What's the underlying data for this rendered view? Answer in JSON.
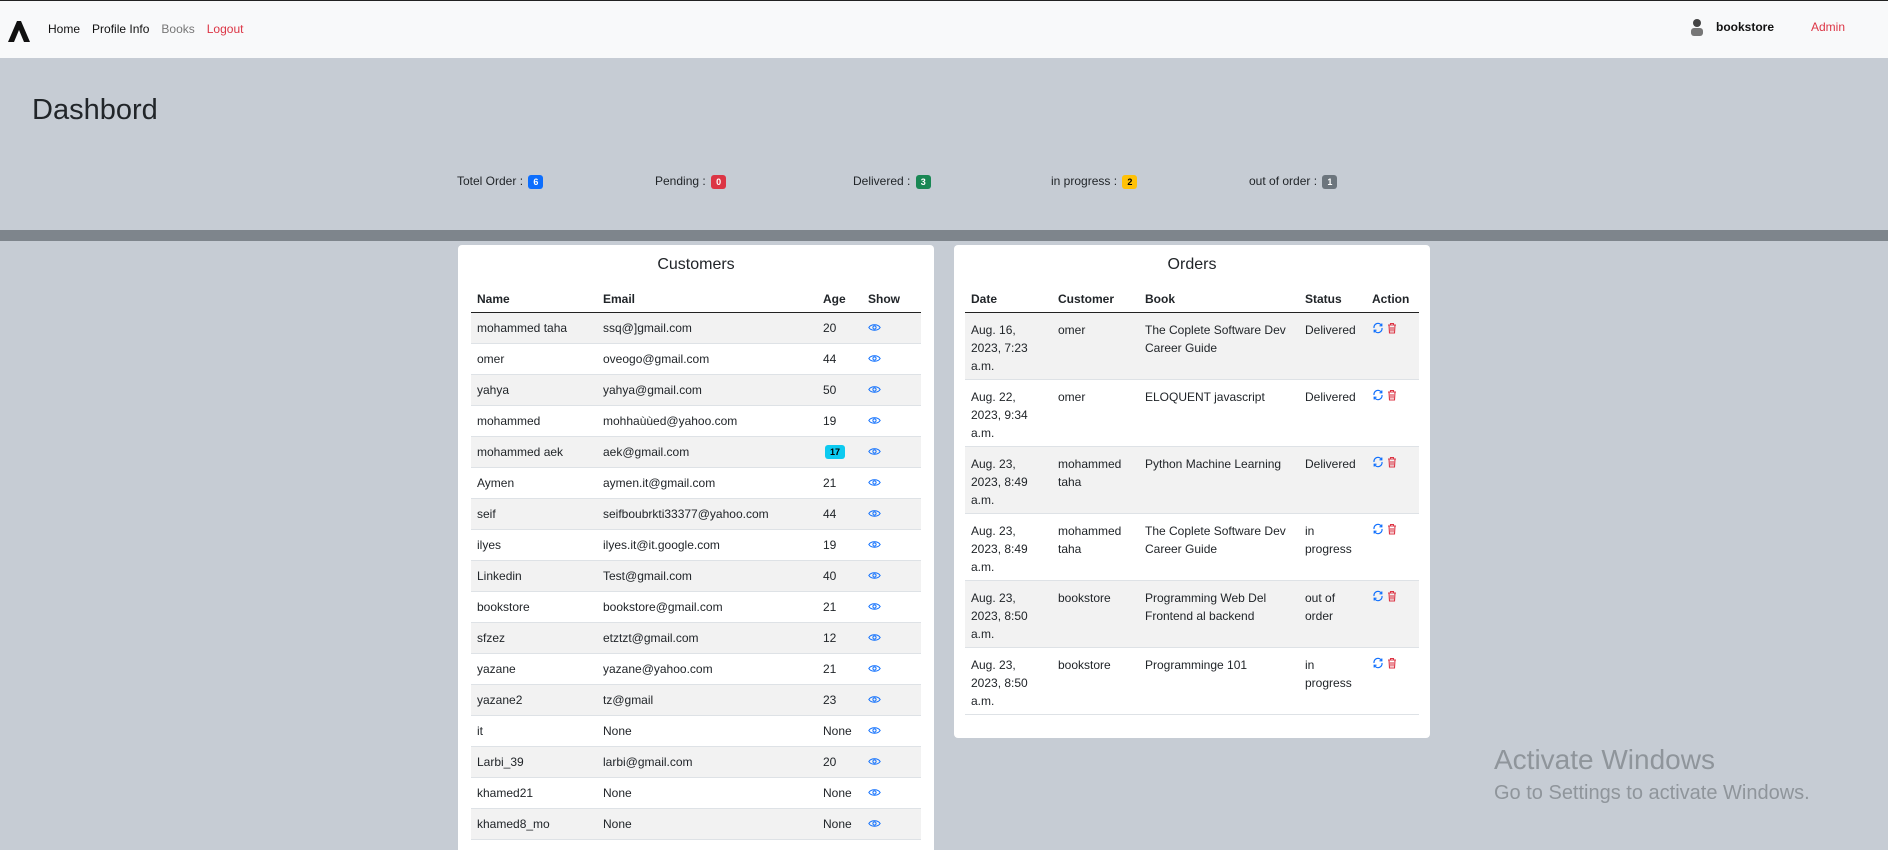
{
  "nav": {
    "links": [
      "Home",
      "Profile Info",
      "Books",
      "Logout"
    ],
    "user_name": "bookstore",
    "admin_label": "Admin"
  },
  "header": {
    "title": "Dashbord",
    "stats": [
      {
        "label": "Totel Order :",
        "value": "6",
        "color": "#0d6efd"
      },
      {
        "label": "Pending :",
        "value": "0",
        "color": "#dc3545"
      },
      {
        "label": "Delivered :",
        "value": "3",
        "color": "#198754"
      },
      {
        "label": "in progress :",
        "value": "2",
        "color": "#ffc107"
      },
      {
        "label": "out of order :",
        "value": "1",
        "color": "#6c757d"
      }
    ]
  },
  "customers": {
    "title": "Customers",
    "columns": [
      "Name",
      "Email",
      "Age",
      "Show"
    ],
    "rows": [
      {
        "name": "mohammed taha",
        "email": "ssq@]gmail.com",
        "age": "20"
      },
      {
        "name": "omer",
        "email": "oveogo@gmail.com",
        "age": "44"
      },
      {
        "name": "yahya",
        "email": "yahya@gmail.com",
        "age": "50"
      },
      {
        "name": "mohammed",
        "email": "mohhaùùed@yahoo.com",
        "age": "19"
      },
      {
        "name": "mohammed aek",
        "email": "aek@gmail.com",
        "age": "17",
        "age_badge": true
      },
      {
        "name": "Aymen",
        "email": "aymen.it@gmail.com",
        "age": "21"
      },
      {
        "name": "seif",
        "email": "seifboubrkti33377@yahoo.com",
        "age": "44"
      },
      {
        "name": "ilyes",
        "email": "ilyes.it@it.google.com",
        "age": "19"
      },
      {
        "name": "Linkedin",
        "email": "Test@gmail.com",
        "age": "40"
      },
      {
        "name": "bookstore",
        "email": "bookstore@gmail.com",
        "age": "21"
      },
      {
        "name": "sfzez",
        "email": "etztzt@gmail.com",
        "age": "12"
      },
      {
        "name": "yazane",
        "email": "yazane@yahoo.com",
        "age": "21"
      },
      {
        "name": "yazane2",
        "email": "tz@gmail",
        "age": "23"
      },
      {
        "name": "it",
        "email": "None",
        "age": "None"
      },
      {
        "name": "Larbi_39",
        "email": "larbi@gmail.com",
        "age": "20"
      },
      {
        "name": "khamed21",
        "email": "None",
        "age": "None"
      },
      {
        "name": "khamed8_mo",
        "email": "None",
        "age": "None"
      }
    ]
  },
  "orders": {
    "title": "Orders",
    "columns": [
      "Date",
      "Customer",
      "Book",
      "Status",
      "Action"
    ],
    "rows": [
      {
        "date": "Aug. 16, 2023, 7:23 a.m.",
        "customer": "omer",
        "book": "The Coplete Software Dev Career Guide",
        "status": "Delivered"
      },
      {
        "date": "Aug. 22, 2023, 9:34 a.m.",
        "customer": "omer",
        "book": "ELOQUENT javascript",
        "status": "Delivered"
      },
      {
        "date": "Aug. 23, 2023, 8:49 a.m.",
        "customer": "mohammed taha",
        "book": "Python Machine Learning",
        "status": "Delivered"
      },
      {
        "date": "Aug. 23, 2023, 8:49 a.m.",
        "customer": "mohammed taha",
        "book": "The Coplete Software Dev Career Guide",
        "status": "in progress"
      },
      {
        "date": "Aug. 23, 2023, 8:50 a.m.",
        "customer": "bookstore",
        "book": "Programming Web Del Frontend al backend",
        "status": "out of order"
      },
      {
        "date": "Aug. 23, 2023, 8:50 a.m.",
        "customer": "bookstore",
        "book": "Programminge 101",
        "status": "in progress"
      }
    ]
  },
  "watermark": {
    "title": "Activate Windows",
    "subtitle": "Go to Settings to activate Windows."
  }
}
